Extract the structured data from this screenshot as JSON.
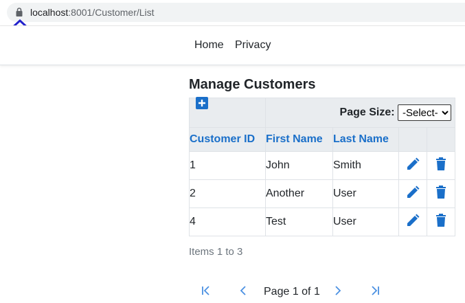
{
  "browser": {
    "url_host": "localhost",
    "url_path": ":8001/Customer/List"
  },
  "nav": {
    "home": "Home",
    "privacy": "Privacy"
  },
  "page": {
    "title": "Manage Customers"
  },
  "toolbar": {
    "page_size_label": "Page Size:",
    "page_size_selected": "-Select-"
  },
  "table": {
    "headers": [
      "Customer ID",
      "First Name",
      "Last Name"
    ],
    "rows": [
      {
        "id": "1",
        "first": "John",
        "last": "Smith"
      },
      {
        "id": "2",
        "first": "Another",
        "last": "User"
      },
      {
        "id": "4",
        "first": "Test",
        "last": "User"
      }
    ]
  },
  "footer": {
    "items_text": "Items 1 to 3",
    "page_text": "Page 1 of 1"
  },
  "colors": {
    "accent": "#1a6fc9",
    "pager": "#4a90e2"
  },
  "icons": [
    "lock-icon",
    "up-arrow-icon",
    "add-icon",
    "edit-icon",
    "delete-icon",
    "first-page-icon",
    "prev-page-icon",
    "next-page-icon",
    "last-page-icon"
  ]
}
